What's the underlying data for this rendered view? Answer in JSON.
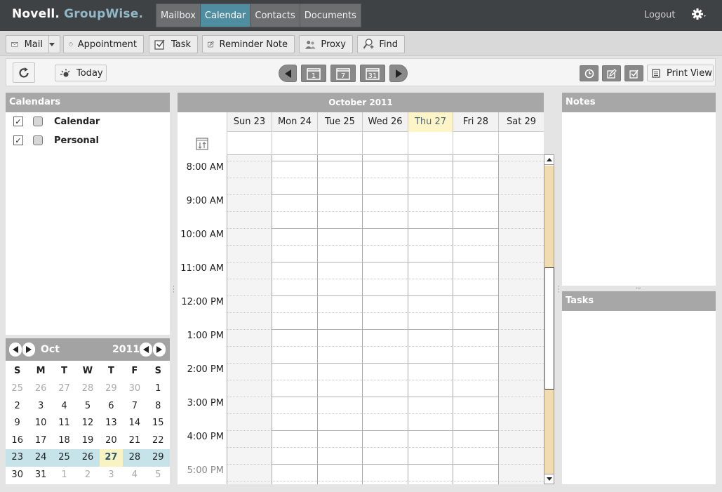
{
  "app": {
    "logo_brand": "Novell.",
    "logo_product": "GroupWise.",
    "logout": "Logout"
  },
  "nav": {
    "tabs": [
      {
        "label": "Mailbox",
        "active": false
      },
      {
        "label": "Calendar",
        "active": true
      },
      {
        "label": "Contacts",
        "active": false
      },
      {
        "label": "Documents",
        "active": false
      }
    ]
  },
  "toolbar": {
    "mail": "Mail",
    "appointment": "Appointment",
    "task": "Task",
    "reminder_note": "Reminder Note",
    "proxy": "Proxy",
    "find": "Find"
  },
  "subbar": {
    "today": "Today",
    "print_view": "Print View"
  },
  "calendars_panel": {
    "title": "Calendars",
    "items": [
      {
        "label": "Calendar",
        "checked": true
      },
      {
        "label": "Personal",
        "checked": true
      }
    ]
  },
  "mini_calendar": {
    "month": "Oct",
    "year": "2011",
    "weekdays": [
      "S",
      "M",
      "T",
      "W",
      "T",
      "F",
      "S"
    ],
    "weeks": [
      [
        {
          "d": "25",
          "o": true
        },
        {
          "d": "26",
          "o": true
        },
        {
          "d": "27",
          "o": true
        },
        {
          "d": "28",
          "o": true
        },
        {
          "d": "29",
          "o": true
        },
        {
          "d": "30",
          "o": true
        },
        {
          "d": "1"
        }
      ],
      [
        {
          "d": "2"
        },
        {
          "d": "3"
        },
        {
          "d": "4"
        },
        {
          "d": "5"
        },
        {
          "d": "6"
        },
        {
          "d": "7"
        },
        {
          "d": "8"
        }
      ],
      [
        {
          "d": "9"
        },
        {
          "d": "10"
        },
        {
          "d": "11"
        },
        {
          "d": "12"
        },
        {
          "d": "13"
        },
        {
          "d": "14"
        },
        {
          "d": "15"
        }
      ],
      [
        {
          "d": "16"
        },
        {
          "d": "17"
        },
        {
          "d": "18"
        },
        {
          "d": "19"
        },
        {
          "d": "20"
        },
        {
          "d": "21"
        },
        {
          "d": "22"
        }
      ],
      [
        {
          "d": "23",
          "w": true
        },
        {
          "d": "24",
          "w": true
        },
        {
          "d": "25",
          "w": true
        },
        {
          "d": "26",
          "w": true
        },
        {
          "d": "27",
          "t": true
        },
        {
          "d": "28",
          "w": true
        },
        {
          "d": "29",
          "w": true
        }
      ],
      [
        {
          "d": "30"
        },
        {
          "d": "31"
        },
        {
          "d": "1",
          "o": true
        },
        {
          "d": "2",
          "o": true
        },
        {
          "d": "3",
          "o": true
        },
        {
          "d": "4",
          "o": true
        },
        {
          "d": "5",
          "o": true
        }
      ]
    ]
  },
  "week_view": {
    "title": "October 2011",
    "days": [
      {
        "label": "Sun 23",
        "today": false
      },
      {
        "label": "Mon 24",
        "today": false
      },
      {
        "label": "Tue 25",
        "today": false
      },
      {
        "label": "Wed 26",
        "today": false
      },
      {
        "label": "Thu 27",
        "today": true
      },
      {
        "label": "Fri 28",
        "today": false
      },
      {
        "label": "Sat 29",
        "today": false
      }
    ],
    "times": [
      "8:00 AM",
      "9:00 AM",
      "10:00 AM",
      "11:00 AM",
      "12:00 PM",
      "1:00 PM",
      "2:00 PM",
      "3:00 PM",
      "4:00 PM",
      "5:00 PM"
    ]
  },
  "notes_panel": {
    "title": "Notes"
  },
  "tasks_panel": {
    "title": "Tasks"
  },
  "colors": {
    "topbar": "#3f4244",
    "active_tab": "#4e8ea0",
    "panel_header": "#a7a7a7",
    "today_highlight": "#fdf4c7",
    "week_highlight": "#c6e3ea",
    "scroll_accent": "#f0dcb0"
  }
}
